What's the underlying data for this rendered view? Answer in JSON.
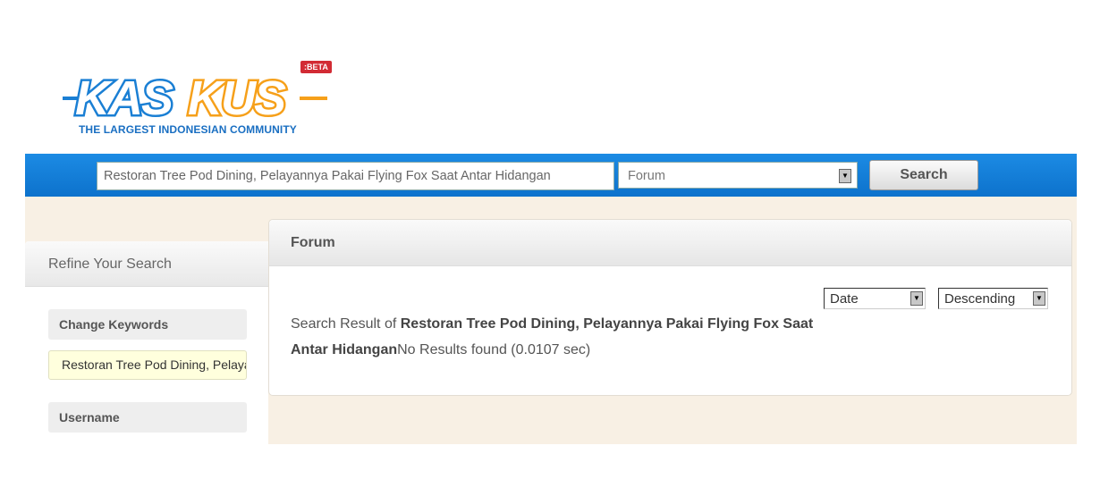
{
  "header": {
    "logo": {
      "text_left": "KAS",
      "text_right": "KUS",
      "badge": ":BETA",
      "tagline": "THE LARGEST INDONESIAN COMMUNITY"
    },
    "colors": {
      "brand_blue": "#1a7fd4",
      "brand_orange": "#f6a01a",
      "bar_blue": "#1580d8"
    },
    "search": {
      "query": "Restoran Tree Pod Dining, Pelayannya Pakai Flying Fox Saat Antar Hidangan",
      "scope": "Forum",
      "button": "Search"
    }
  },
  "sidebar": {
    "title": "Refine Your Search",
    "change_keywords_label": "Change Keywords",
    "keywords_value": "Restoran Tree Pod Dining, Pelayannya Pakai Flying Fox Saat Antar Hidangan",
    "username_label": "Username"
  },
  "main": {
    "title": "Forum",
    "sort_by": "Date",
    "sort_order": "Descending",
    "result_prefix": "Search Result of ",
    "result_query": "Restoran Tree Pod Dining, Pelayannya Pakai Flying Fox Saat Antar Hidangan",
    "result_status": "No Results found (0.0107 sec)"
  }
}
